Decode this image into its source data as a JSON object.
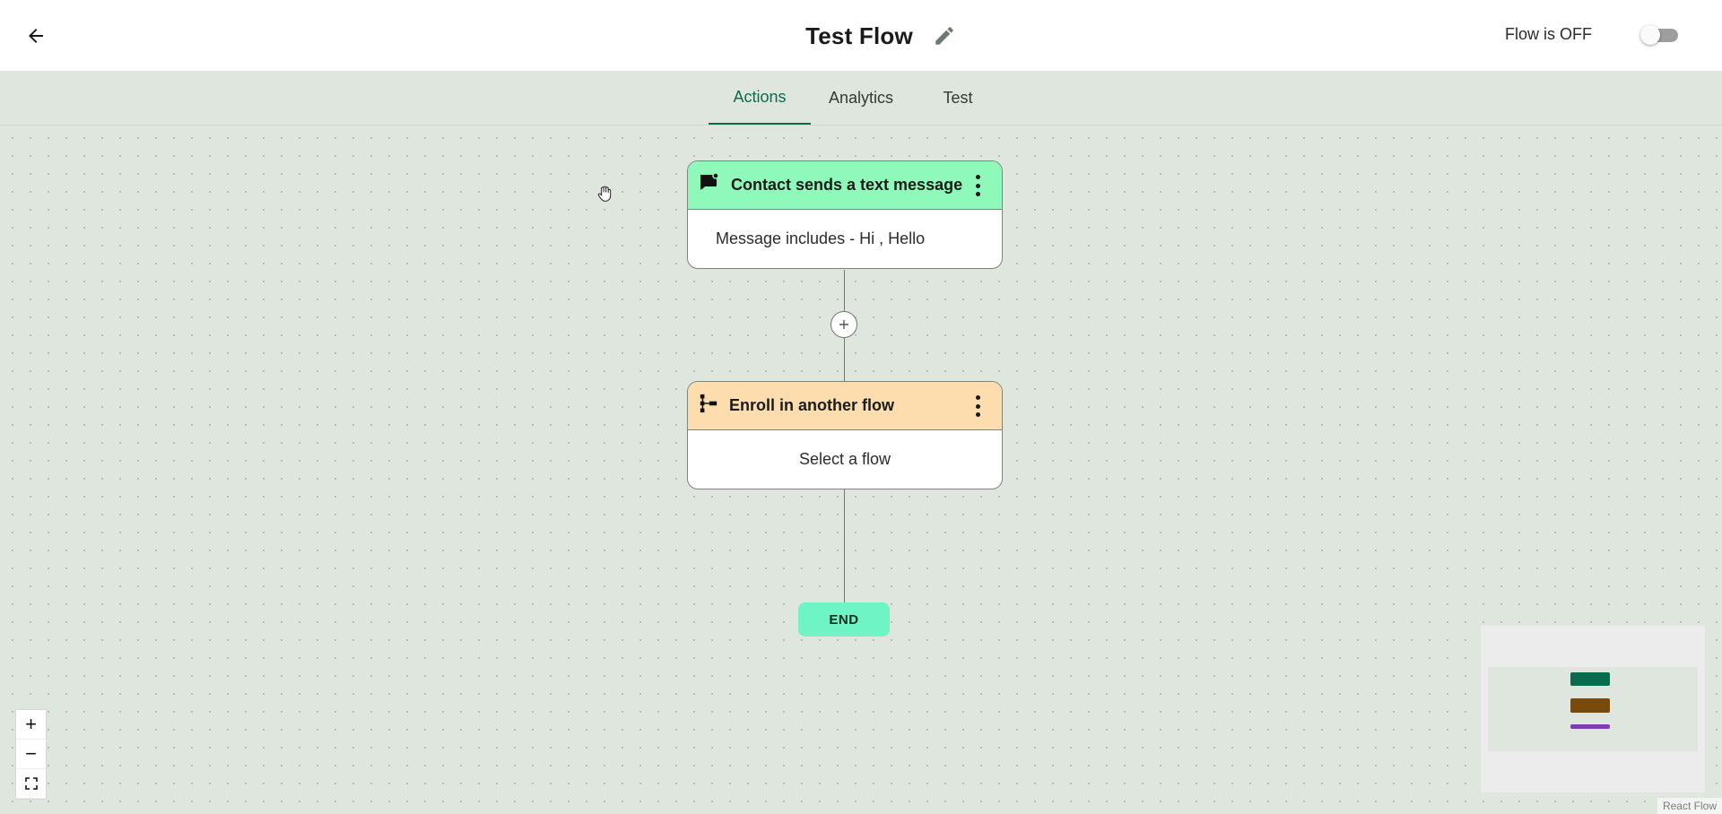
{
  "header": {
    "title": "Test Flow",
    "flow_status": "Flow is OFF",
    "flow_enabled": false
  },
  "tabs": [
    {
      "label": "Actions",
      "active": true
    },
    {
      "label": "Analytics",
      "active": false
    },
    {
      "label": "Test",
      "active": false
    }
  ],
  "nodes": {
    "trigger": {
      "title": "Contact sends a text message",
      "body": "Message includes - Hi , Hello",
      "color": "#8ef9b8",
      "icon": "sms-icon"
    },
    "action": {
      "title": "Enroll in another flow",
      "body": "Select a flow",
      "color": "#fddcae",
      "icon": "flow-tree-icon"
    }
  },
  "end_label": "END",
  "controls": {
    "zoom_in": "+",
    "zoom_out": "−"
  },
  "minimap_colors": [
    "#0b6b4e",
    "#7a4a0c",
    "#7b3fb3"
  ],
  "attribution": "React Flow"
}
